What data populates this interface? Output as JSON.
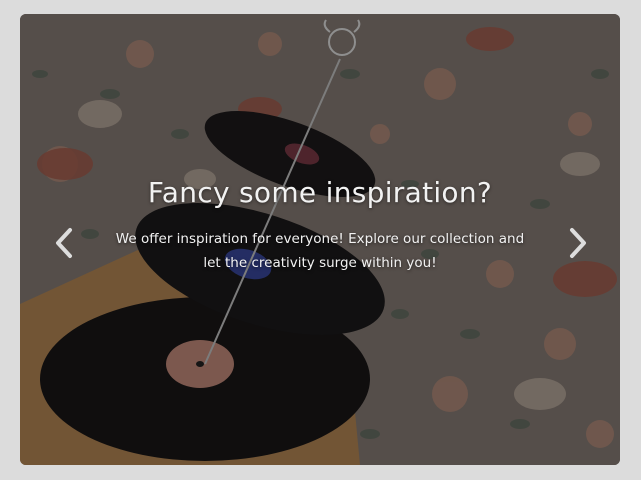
{
  "carousel": {
    "slide": {
      "image_alt": "three-tier vinyl record stand on floral wallpaper",
      "title": "Fancy some inspiration?",
      "text": "We offer inspiration for everyone! Explore our collection and let the creativity surge within you!"
    },
    "controls": {
      "prev_icon": "chevron-left-icon",
      "next_icon": "chevron-right-icon"
    }
  },
  "colors": {
    "page_background": "#dcdcdc",
    "caption_text": "#f2f2f2",
    "arrow": "#dddddd"
  }
}
